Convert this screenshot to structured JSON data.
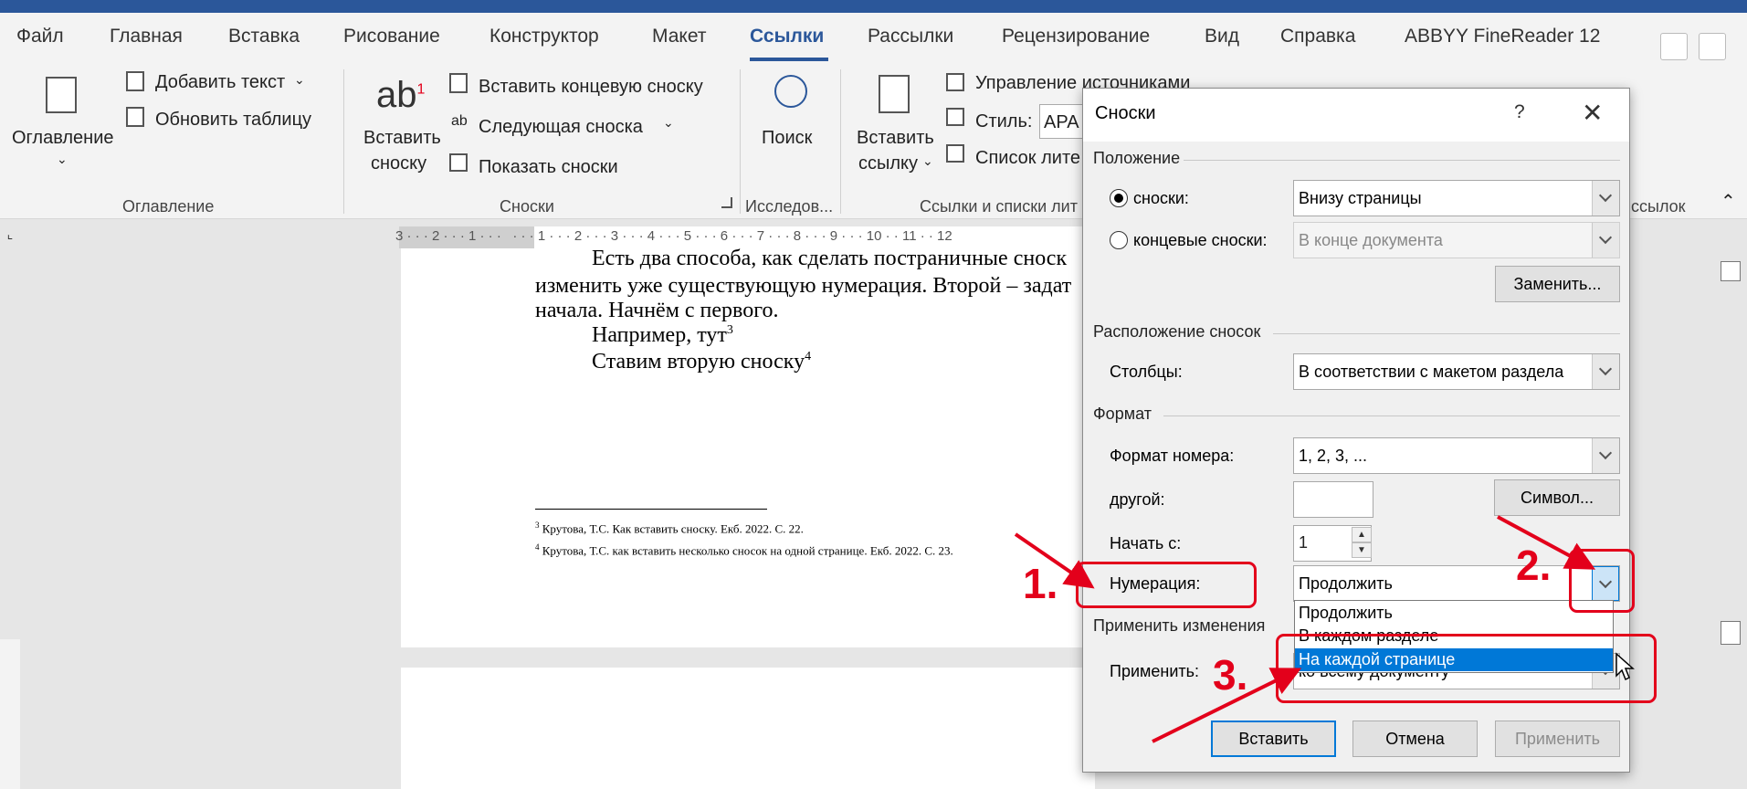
{
  "ribbon_tabs": [
    "Файл",
    "Главная",
    "Вставка",
    "Рисование",
    "Конструктор",
    "Макет",
    "Ссылки",
    "Рассылки",
    "Рецензирование",
    "Вид",
    "Справка",
    "ABBYY FineReader 12"
  ],
  "active_tab": "Ссылки",
  "ribbon": {
    "toc": {
      "button": "Оглавление",
      "add_text": "Добавить текст",
      "update_table": "Обновить таблицу",
      "group": "Оглавление"
    },
    "footnotes": {
      "insert_footnote_line1": "Вставить",
      "insert_footnote_line2": "сноску",
      "ab_icon": "ab",
      "ab_sup": "1",
      "insert_endnote": "Вставить концевую сноску",
      "next_footnote": "Следующая сноска",
      "show_notes": "Показать сноски",
      "group": "Сноски"
    },
    "research": {
      "button": "Поиск",
      "group": "Исследов..."
    },
    "citations": {
      "insert_citation_line1": "Вставить",
      "insert_citation_line2": "ссылку",
      "manage_sources": "Управление источниками",
      "style_label": "Стиль:",
      "style_value": "APA",
      "bibliography": "Список лите",
      "group": "Ссылки и списки лит",
      "group_tail": "ссылок"
    }
  },
  "ruler": {
    "text": "3 · · · 2 · · · 1 · · ·   · · · 1 · · · 2 · · · 3 · · · 4 · · · 5 · · · 6 · · · 7 · · · 8 · · · 9 · · · 10 · · 11 · · 12"
  },
  "document": {
    "line1": "Есть два способа, как сделать постраничные сноск",
    "line2": "изменить уже существующую нумерация. Второй – задат",
    "line3": "начала. Начнём с первого.",
    "line4_text": "Например, тут",
    "line4_sup": "3",
    "line5_text": "Ставим вторую сноску",
    "line5_sup": "4",
    "footnote1_num": "3",
    "footnote1_text": "Крутова, Т.С. Как вставить сноску. Екб. 2022. С. 22.",
    "footnote2_num": "4",
    "footnote2_text": "Крутова, Т.С. как вставить несколько сносок на одной странице. Екб. 2022. С. 23."
  },
  "dialog": {
    "title": "Сноски",
    "help": "?",
    "location_section": "Положение",
    "footnotes_label": "сноски:",
    "footnotes_value": "Внизу страницы",
    "endnotes_label": "концевые сноски:",
    "endnotes_value": "В конце документа",
    "convert_button": "Заменить...",
    "layout_section": "Расположение сносок",
    "columns_label": "Столбцы:",
    "columns_value": "В соответствии с макетом раздела",
    "format_section": "Формат",
    "number_format_label": "Формат номера:",
    "number_format_value": "1, 2, 3, ...",
    "custom_mark_label": "другой:",
    "custom_mark_value": "",
    "symbol_button": "Символ...",
    "start_at_label": "Начать с:",
    "start_at_value": "1",
    "numbering_label": "Нумерация:",
    "numbering_value": "Продолжить",
    "numbering_options": [
      "Продолжить",
      "В каждом разделе",
      "На каждой странице"
    ],
    "numbering_highlighted": "На каждой странице",
    "apply_changes_section": "Применить изменения",
    "apply_to_label": "Применить:",
    "apply_to_value": "ко всему документу",
    "insert_button": "Вставить",
    "cancel_button": "Отмена",
    "apply_button": "Применить"
  },
  "annotations": [
    "1.",
    "2.",
    "3."
  ],
  "colors": {
    "accent": "#2b579a",
    "annotation": "#e3001b",
    "selection": "#0078d7"
  }
}
